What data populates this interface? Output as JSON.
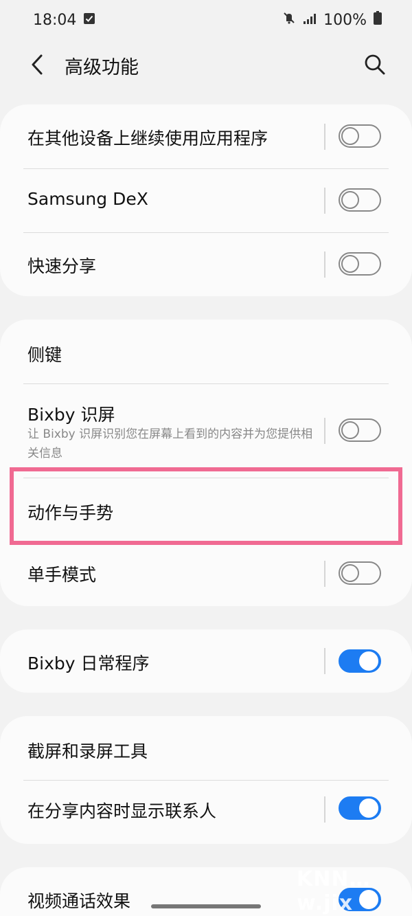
{
  "status_bar": {
    "time": "18:04",
    "battery": "100%"
  },
  "header": {
    "title": "高级功能"
  },
  "cards": {
    "c1": {
      "continue_apps": {
        "label": "在其他设备上继续使用应用程序",
        "state": "off"
      },
      "samsung_dex": {
        "label": "Samsung DeX",
        "state": "off"
      },
      "quick_share": {
        "label": "快速分享",
        "state": "off"
      }
    },
    "c2": {
      "side_key": {
        "label": "侧键"
      },
      "bixby_vision": {
        "label": "Bixby 识屏",
        "sub": "让 Bixby 识屏识别您在屏幕上看到的内容并为您提供相关信息",
        "state": "off"
      },
      "motions_gestures": {
        "label": "动作与手势"
      },
      "one_hand": {
        "label": "单手模式",
        "state": "off"
      }
    },
    "c3": {
      "bixby_routines": {
        "label": "Bixby 日常程序",
        "state": "on"
      }
    },
    "c4": {
      "screenshot_tools": {
        "label": "截屏和录屏工具"
      },
      "show_contacts": {
        "label": "在分享内容时显示联系人",
        "state": "on"
      },
      "video_effects": {
        "label": "视频通话效果"
      }
    }
  },
  "colors": {
    "accent": "#1d7cf2",
    "highlight": "#f06a92"
  },
  "watermark": "KNN…w.jix"
}
